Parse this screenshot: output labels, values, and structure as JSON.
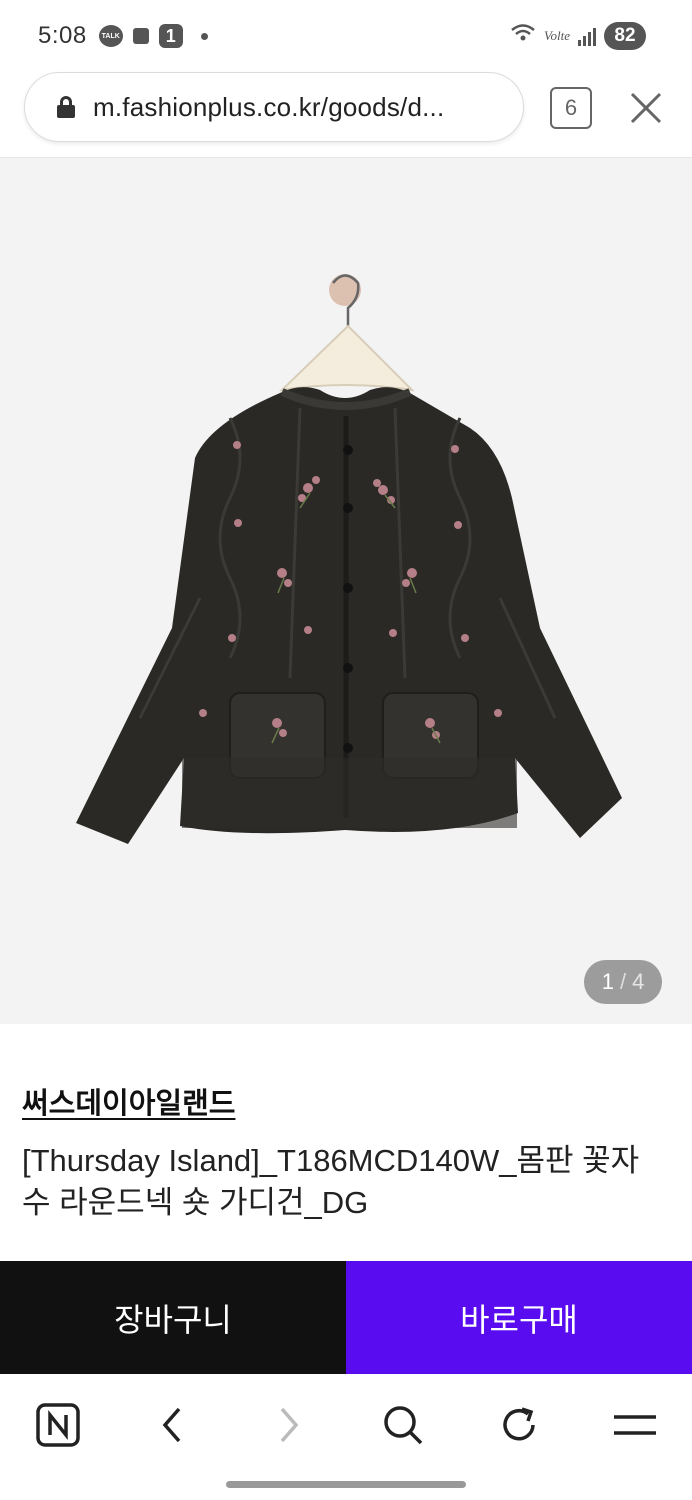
{
  "status_bar": {
    "time": "5:08",
    "talk_icon_text": "TALK",
    "notification_badge": "1",
    "volte": "Volte",
    "battery": "82"
  },
  "browser": {
    "url": "m.fashionplus.co.kr/goods/d...",
    "tab_count": "6"
  },
  "product": {
    "image_index": "1",
    "image_separator": "/",
    "image_total": "4",
    "brand": "써스데이아일랜드",
    "name": "[Thursday Island]_T186MCD140W_몸판 꽃자수 라운드넥 숏 가디건_DG"
  },
  "actions": {
    "cart_label": "장바구니",
    "buy_label": "바로구매"
  },
  "colors": {
    "buy_button": "#5a0cf0",
    "cart_button": "#111111",
    "image_background": "#f3f3f3"
  },
  "icons": {
    "nav": [
      "naver-home-icon",
      "back-arrow-icon",
      "forward-arrow-icon",
      "search-icon",
      "refresh-icon",
      "menu-icon"
    ]
  }
}
